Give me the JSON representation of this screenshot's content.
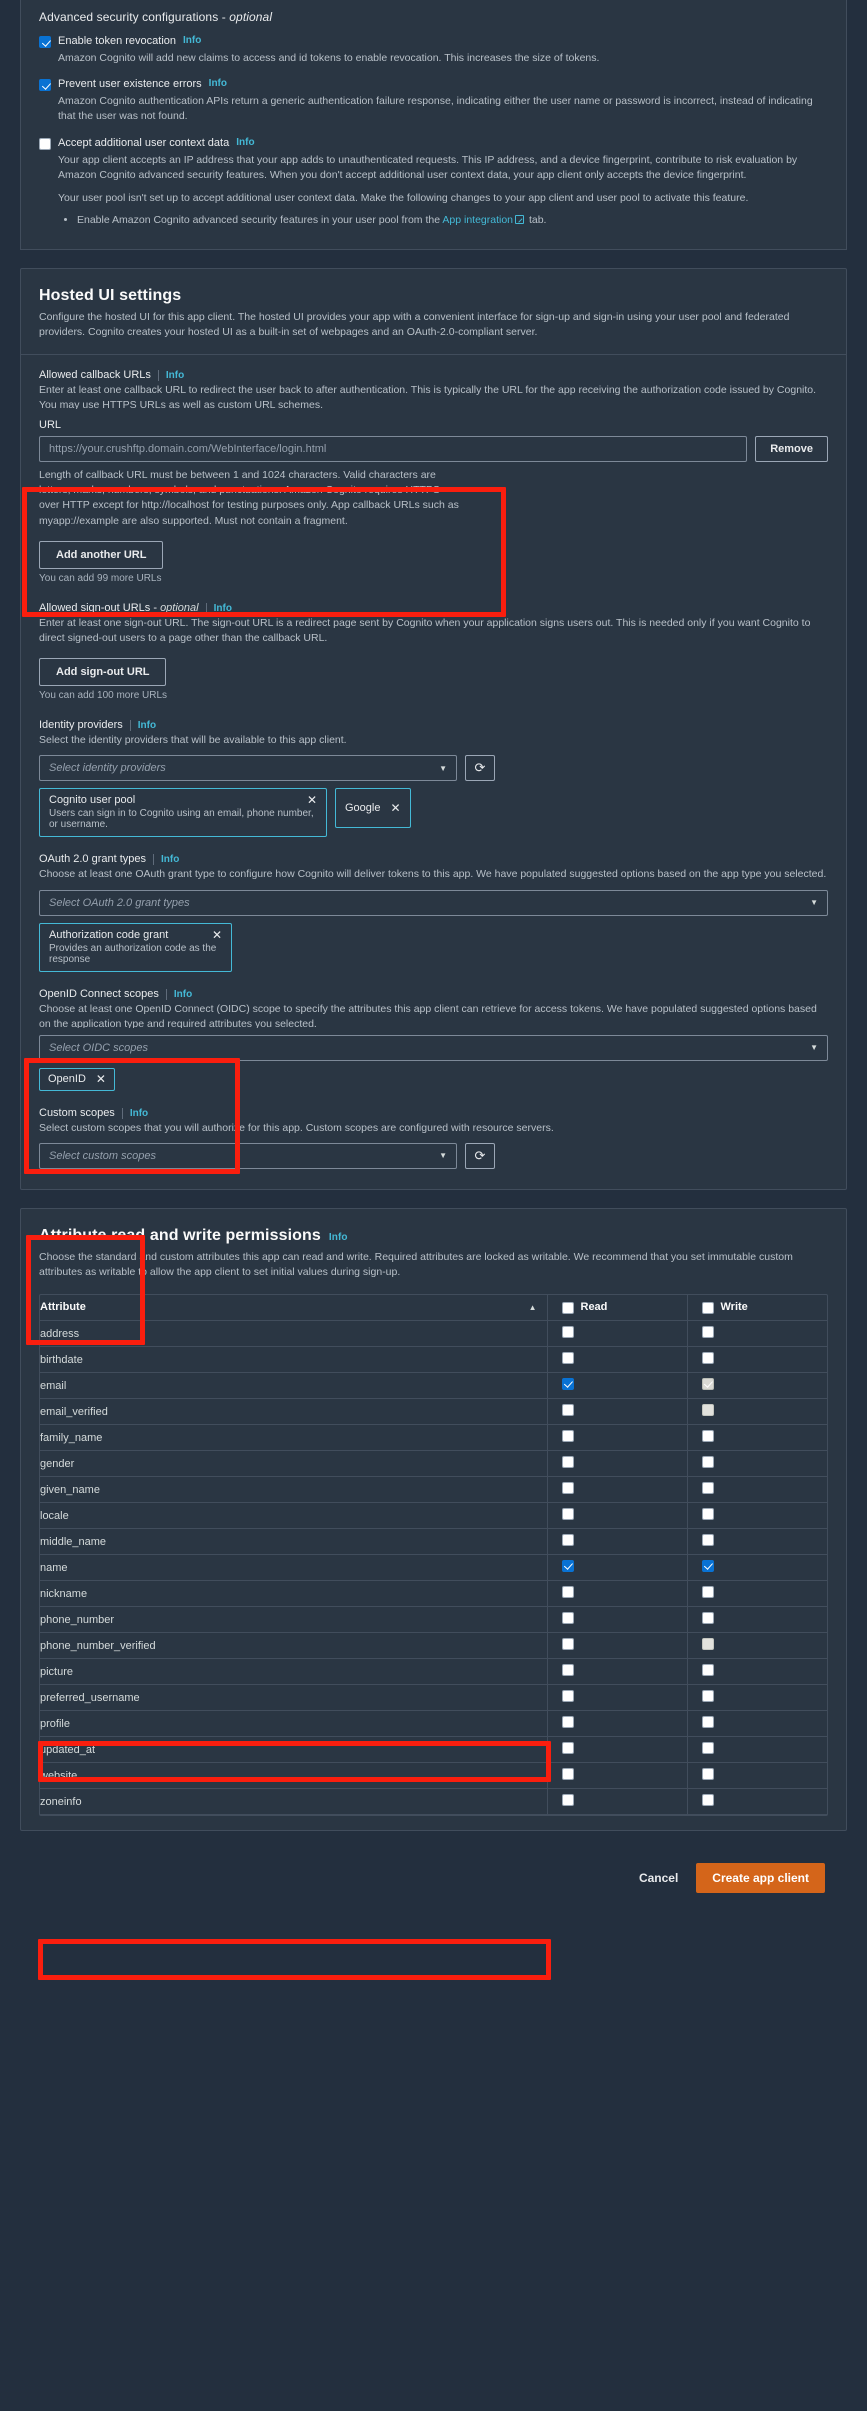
{
  "advanced_security": {
    "title": "Advanced security configurations - ",
    "title_optional": "optional",
    "items": [
      {
        "label": "Enable token revocation",
        "info": "Info",
        "checked": true,
        "desc": "Amazon Cognito will add new claims to access and id tokens to enable revocation. This increases the size of tokens."
      },
      {
        "label": "Prevent user existence errors",
        "info": "Info",
        "checked": true,
        "desc": "Amazon Cognito authentication APIs return a generic authentication failure response, indicating either the user name or password is incorrect, instead of indicating that the user was not found."
      },
      {
        "label": "Accept additional user context data",
        "info": "Info",
        "checked": false,
        "desc": "Your app client accepts an IP address that your app adds to unauthenticated requests. This IP address, and a device fingerprint, contribute to risk evaluation by Amazon Cognito advanced security features. When you don't accept additional user context data, your app client only accepts the device fingerprint.",
        "desc2": "Your user pool isn't set up to accept additional user context data. Make the following changes to your app client and user pool to activate this feature.",
        "bullet_pre": "Enable Amazon Cognito advanced security features in your user pool from the ",
        "bullet_link": "App integration",
        "bullet_post": " tab."
      }
    ]
  },
  "hosted_ui": {
    "title": "Hosted UI settings",
    "desc": "Configure the hosted UI for this app client. The hosted UI provides your app with a convenient interface for sign-up and sign-in using your user pool and federated providers. Cognito creates your hosted UI as a built-in set of webpages and an OAuth-2.0-compliant server.",
    "callback": {
      "label": "Allowed callback URLs",
      "info": "Info",
      "desc": "Enter at least one callback URL to redirect the user back to after authentication. This is typically the URL for the app receiving the authorization code issued by Cognito. You may use HTTPS URLs as well as custom URL schemes.",
      "url_label": "URL",
      "url_value": "https://your.crushftp.domain.com/WebInterface/login.html",
      "remove_label": "Remove",
      "constraint": "Length of callback URL must be between 1 and 1024 characters. Valid characters are letters, marks, numbers, symbols, and punctuations. Amazon Cognito requires HTTPS over HTTP except for http://localhost for testing purposes only. App callback URLs such as myapp://example are also supported. Must not contain a fragment.",
      "add_label": "Add another URL",
      "remaining": "You can add 99 more URLs"
    },
    "signout": {
      "label": "Allowed sign-out URLs - ",
      "label_optional": "optional",
      "info": "Info",
      "desc": "Enter at least one sign-out URL. The sign-out URL is a redirect page sent by Cognito when your application signs users out. This is needed only if you want Cognito to direct signed-out users to a page other than the callback URL.",
      "add_label": "Add sign-out URL",
      "remaining": "You can add 100 more URLs"
    },
    "identity_providers": {
      "label": "Identity providers",
      "info": "Info",
      "desc": "Select the identity providers that will be available to this app client.",
      "placeholder": "Select identity providers",
      "refresh_icon": "refresh-icon",
      "selected": [
        {
          "title": "Cognito user pool",
          "sub": "Users can sign in to Cognito using an email, phone number, or username.",
          "remove": "✕"
        },
        {
          "title": "Google",
          "sub": "",
          "remove": "✕"
        }
      ]
    },
    "oauth_grants": {
      "label": "OAuth 2.0 grant types",
      "info": "Info",
      "desc": "Choose at least one OAuth grant type to configure how Cognito will deliver tokens to this app. We have populated suggested options based on the app type you selected.",
      "placeholder": "Select OAuth 2.0 grant types",
      "selected": [
        {
          "title": "Authorization code grant",
          "sub": "Provides an authorization code as the response",
          "remove": "✕"
        }
      ]
    },
    "oidc_scopes": {
      "label": "OpenID Connect scopes",
      "info": "Info",
      "desc": "Choose at least one OpenID Connect (OIDC) scope to specify the attributes this app client can retrieve for access tokens. We have populated suggested options based on the application type and required attributes you selected.",
      "placeholder": "Select OIDC scopes",
      "selected": [
        {
          "title": "OpenID",
          "sub": "",
          "remove": "✕"
        }
      ]
    },
    "custom_scopes": {
      "label": "Custom scopes",
      "info": "Info",
      "desc": "Select custom scopes that you will authorize for this app. Custom scopes are configured with resource servers.",
      "placeholder": "Select custom scopes",
      "refresh_icon": "refresh-icon"
    }
  },
  "attributes": {
    "title": "Attribute read and write permissions",
    "info": "Info",
    "desc": "Choose the standard and custom attributes this app can read and write. Required attributes are locked as writable. We recommend that you set immutable custom attributes as writable to allow the app client to set initial values during sign-up.",
    "columns": {
      "attribute": "Attribute",
      "read": "Read",
      "write": "Write",
      "sort_arrow": "▲"
    },
    "header_read_checked": false,
    "header_write_checked": false,
    "rows": [
      {
        "name": "address",
        "read": "unchecked",
        "write": "unchecked"
      },
      {
        "name": "birthdate",
        "read": "unchecked",
        "write": "unchecked"
      },
      {
        "name": "email",
        "read": "checked",
        "write": "locked"
      },
      {
        "name": "email_verified",
        "read": "unchecked",
        "write": "disabled"
      },
      {
        "name": "family_name",
        "read": "unchecked",
        "write": "unchecked"
      },
      {
        "name": "gender",
        "read": "unchecked",
        "write": "unchecked"
      },
      {
        "name": "given_name",
        "read": "unchecked",
        "write": "unchecked"
      },
      {
        "name": "locale",
        "read": "unchecked",
        "write": "unchecked"
      },
      {
        "name": "middle_name",
        "read": "unchecked",
        "write": "unchecked"
      },
      {
        "name": "name",
        "read": "checked",
        "write": "checked"
      },
      {
        "name": "nickname",
        "read": "unchecked",
        "write": "unchecked"
      },
      {
        "name": "phone_number",
        "read": "unchecked",
        "write": "unchecked"
      },
      {
        "name": "phone_number_verified",
        "read": "unchecked",
        "write": "disabled"
      },
      {
        "name": "picture",
        "read": "unchecked",
        "write": "unchecked"
      },
      {
        "name": "preferred_username",
        "read": "unchecked",
        "write": "unchecked"
      },
      {
        "name": "profile",
        "read": "unchecked",
        "write": "unchecked"
      },
      {
        "name": "updated_at",
        "read": "unchecked",
        "write": "unchecked"
      },
      {
        "name": "website",
        "read": "unchecked",
        "write": "unchecked"
      },
      {
        "name": "zoneinfo",
        "read": "unchecked",
        "write": "unchecked"
      }
    ]
  },
  "footer": {
    "cancel": "Cancel",
    "create": "Create app client"
  },
  "annotation_color": "#fa1e0e"
}
